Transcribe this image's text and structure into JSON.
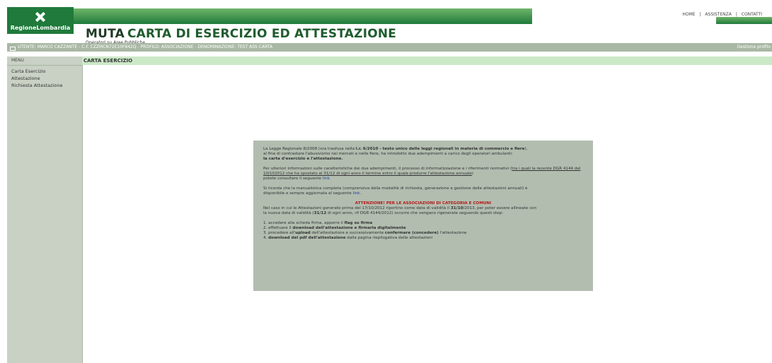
{
  "brand": {
    "logo_text": "RegioneLombardia"
  },
  "top_links": [
    "HOME",
    "|",
    "ASSISTENZA",
    "|",
    "CONTATTI"
  ],
  "header": {
    "muta": "MUTA",
    "title": "CARTA DI ESERCIZIO ED ATTESTAZIONE",
    "subtitle": "Operatori su Aree Pubbliche"
  },
  "userbar": {
    "text": "UTENTE: MARCO CAZZANTE - C.F. CZZMCN72E10F842Q - PROFILO: ASSOCIAZIONE - DENOMINAZIONE: TEST ASS CARTA",
    "profile_link": "Gestione profilo"
  },
  "sidebar": {
    "menu_label": "MENU",
    "items": [
      "Carta Esercizio",
      "Attestazione",
      "Richiesta Attestazione"
    ]
  },
  "section": {
    "title": "CARTA ESERCIZIO"
  },
  "panel": {
    "p1a": "La Legge Regionale 8/2008 (ora trasfusa nella ",
    "p1b": "l.r. 6/2010 - testo unico delle leggi regionali in materia di commercio e fiere",
    "p1c": "),",
    "p1d": "al fine di contrastare l'abusivismo nei mercati e nelle fiere, ha introdotto due adempimenti a carico degli operatori ambulanti:",
    "p1e": "la carta d'esercizio e l'attestazione.",
    "p2a": "Per ulteriori informazioni sulle caratteristiche dei due adempimenti, il processo di informatizzazione e i riferimenti normativi (",
    "p2b": "tra i quali la recente DGR 4144 del 10/102012 che ha spostato al 31/12 di ogni anno il termine entro il quale produrre l'attestazione annuale",
    "p2c": ")",
    "p2d": "potete consultare il seguente ",
    "link": "link",
    "p3a": "Si ricorda che la manualistica completa (comprensiva della modalità di richiesta, generazione e gestione delle attestazioni annuali) è",
    "p3b": "disponibile e sempre aggiornata al seguente ",
    "warn": "ATTENZIONE! PER LE ASSOCIAZIONI DI CATEGORIA E COMUNI",
    "p4a": "Nel caso in cui le Attestazioni generate prima del 17/10/2012 riportino come data di validità il ",
    "p4b": "31/10",
    "p4c": "/2013, per poter essere allineate con",
    "p4d": "la nuova data di validità (",
    "p4e": "31/12",
    "p4f": " di ogni anno, rif DGR 4144/2012) occorre che vengano rigenerate seguendo questi step:",
    "s1a": "1. accedere alla scheda firma, apporre il ",
    "s1b": "flag su firma",
    "s2a": "2. effettuare il ",
    "s2b": "download dell'attestazione e firmarla digitalmente",
    "s3a": "3. procedere all'",
    "s3b": "upload",
    "s3c": " dell'attestazione e successivamente ",
    "s3d": "confermare (concedere)",
    "s3e": " l'attestazione",
    "s4a": "4. ",
    "s4b": "download del pdf dell'attestazione",
    "s4c": " dalla pagina riepilogativa delle attestazioni"
  },
  "colors": {
    "brand_green": "#1f7a3b",
    "panel_bg": "#b2bdaf",
    "section_bg": "#cbe8c7",
    "warn": "#b21a1a",
    "link": "#1a3fa0"
  }
}
